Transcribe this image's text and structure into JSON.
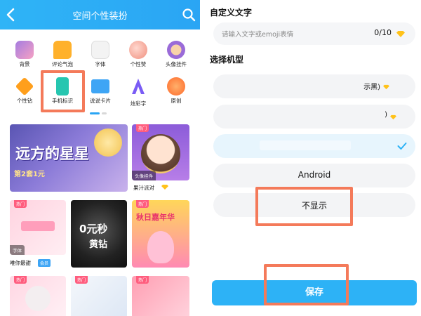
{
  "left": {
    "header": {
      "title": "空间个性装扮",
      "back_icon": "chevron-left-icon",
      "search_icon": "search-icon",
      "bg": "#2aa5f4"
    },
    "icons": [
      {
        "label": "背景",
        "icon": "background-icon",
        "color": "#c98bd6"
      },
      {
        "label": "评论气泡",
        "icon": "comment-bubble-icon",
        "color": "#ffb12b"
      },
      {
        "label": "字体",
        "icon": "font-icon",
        "color": "#f1f1f1"
      },
      {
        "label": "个性赞",
        "icon": "like-icon",
        "color": "#f7b4a8"
      },
      {
        "label": "头像挂件",
        "icon": "avatar-pendant-icon",
        "color": "#b98bdf"
      },
      {
        "label": "个性钻",
        "icon": "diamond-icon",
        "color": "#ff9f1c"
      },
      {
        "label": "手机标识",
        "icon": "phone-tag-icon",
        "color": "#26c6b0"
      },
      {
        "label": "说说卡片",
        "icon": "status-card-icon",
        "color": "#3ea5f5"
      },
      {
        "label": "炫彩字",
        "icon": "colorful-text-icon",
        "color": "#7a5cf5"
      },
      {
        "label": "原创",
        "icon": "original-icon",
        "color": "#ff7a3d"
      }
    ],
    "banner": {
      "title": "远方的星星",
      "subtitle": "第2套1元"
    },
    "card_avatar": {
      "tag": "热门",
      "cat": "头像挂件",
      "caption": "果汁派对"
    },
    "row2": [
      {
        "tag": "热门",
        "cat": "字体",
        "caption": "唯你最甜",
        "badge": "会员"
      },
      {
        "title": "0元秒",
        "subtitle": "黄钻"
      },
      {
        "tag": "热门",
        "title": "秋日嘉年华"
      }
    ],
    "row3": [
      {
        "tag": "热门"
      },
      {
        "tag": "热门"
      },
      {
        "tag": "热门"
      }
    ]
  },
  "right": {
    "custom_text_title": "自定义文字",
    "text_input": {
      "placeholder": "请输入文字或emoji表情",
      "count": "0/10"
    },
    "model_title": "选择机型",
    "options": [
      {
        "label": "示黑)",
        "selected": false
      },
      {
        "label": ")",
        "selected": false
      },
      {
        "label": "",
        "selected": true
      },
      {
        "label": "Android",
        "selected": false
      },
      {
        "label": "不显示",
        "selected": false
      }
    ],
    "save_label": "保存",
    "accent": "#2db2f6",
    "highlight": "#f47a5a"
  }
}
